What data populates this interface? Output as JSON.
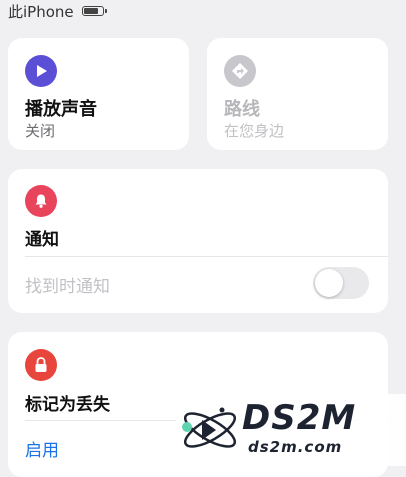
{
  "status_bar": {
    "device_label": "此iPhone",
    "battery_icon": "battery-icon"
  },
  "play_sound": {
    "title": "播放声音",
    "status": "关闭",
    "icon": "play-icon",
    "color": "#5b4fd6"
  },
  "directions": {
    "title": "路线",
    "status": "在您身边",
    "icon": "directions-icon",
    "color": "#c7c7cc"
  },
  "notifications": {
    "title": "通知",
    "icon": "bell-icon",
    "color": "#e8455c",
    "notify_when_found": {
      "label": "找到时通知",
      "enabled": false
    }
  },
  "mark_as_lost": {
    "title": "标记为丢失",
    "icon": "lock-icon",
    "color": "#e8453c",
    "action_label": "启用",
    "action_color": "#1a73e8"
  },
  "watermark": {
    "logo_text": "DS2M",
    "domain_text": "ds2m.com"
  }
}
